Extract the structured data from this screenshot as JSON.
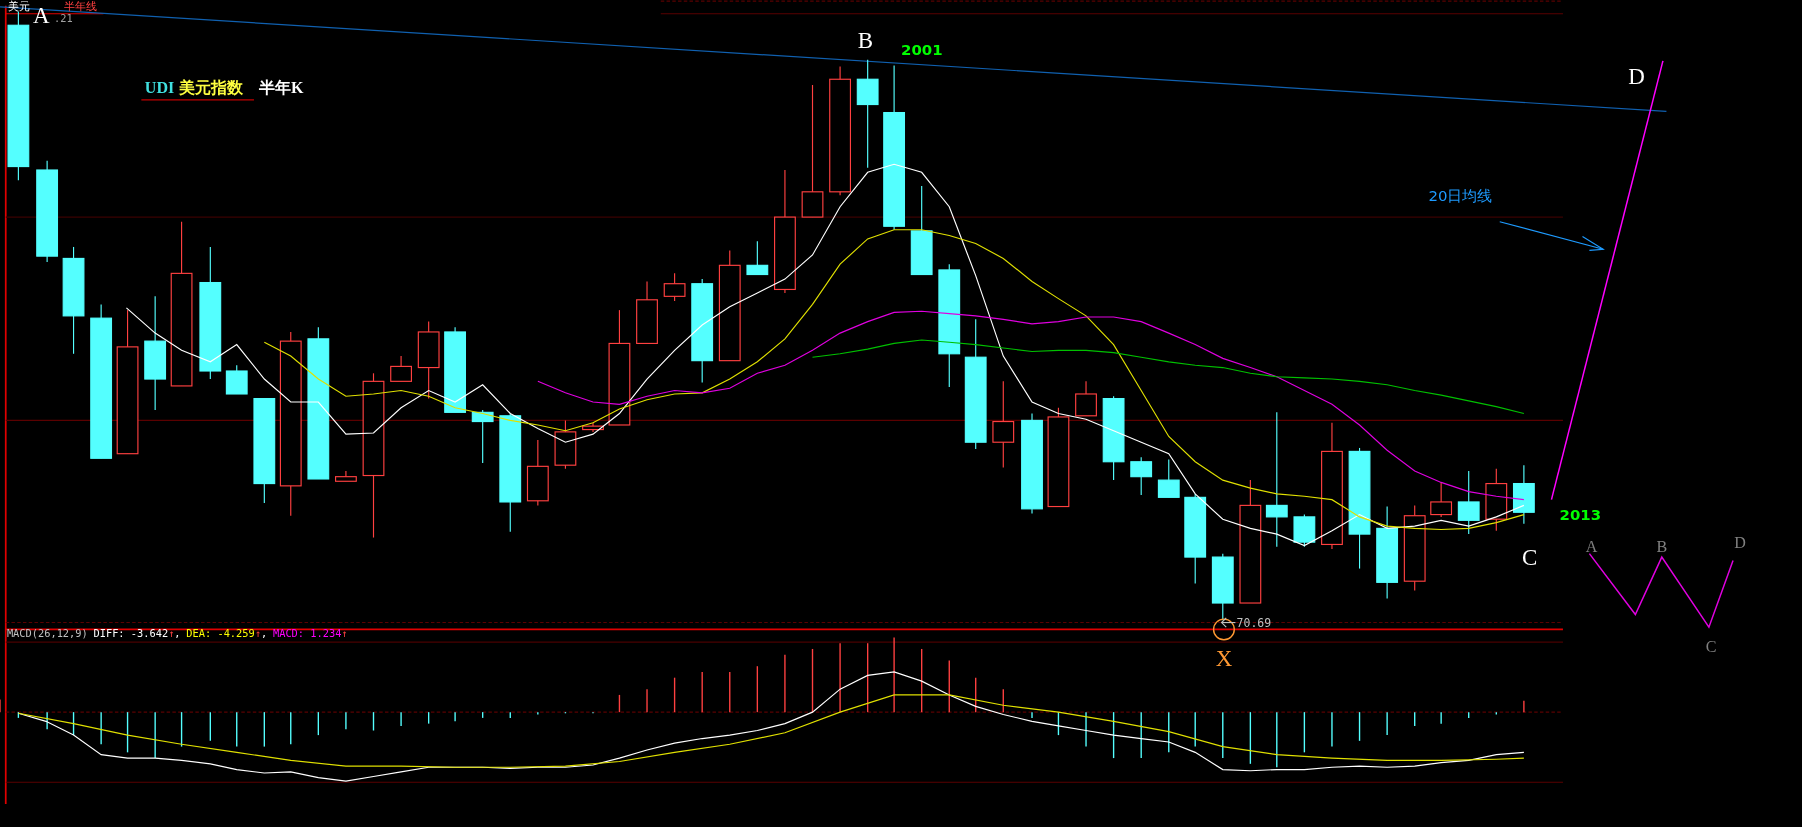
{
  "header": {
    "symbol": "美元",
    "overlay": "半年线",
    "price": ".21"
  },
  "title": {
    "code": "UDI",
    "name": "美元指数",
    "period": "半年K"
  },
  "annotations": [
    {
      "kind": "point",
      "text": "A"
    },
    {
      "kind": "point",
      "text": "B"
    },
    {
      "kind": "year",
      "text": "2001"
    },
    {
      "kind": "point",
      "text": "D"
    },
    {
      "kind": "note",
      "text": "20日均线"
    },
    {
      "kind": "year",
      "text": "2013"
    },
    {
      "kind": "point",
      "text": "C"
    },
    {
      "kind": "pivot",
      "text": "X"
    },
    {
      "kind": "legend",
      "text": "A"
    },
    {
      "kind": "legend",
      "text": "B"
    },
    {
      "kind": "legend",
      "text": "C"
    },
    {
      "kind": "legend",
      "text": "D"
    }
  ],
  "low_marker": {
    "text": "70.69"
  },
  "macd": {
    "name": "MACD(26,12,9)",
    "values": [
      {
        "text": "DIFF: -3.642",
        "arrow": "↑",
        "sep": ",",
        "color": "#ffffff"
      },
      {
        "text": "DEA: -4.259",
        "arrow": "↑",
        "sep": ",",
        "color": "#ffff00"
      },
      {
        "text": "MACD: 1.234",
        "arrow": "↑",
        "color": "#ff00ff"
      }
    ]
  }
}
